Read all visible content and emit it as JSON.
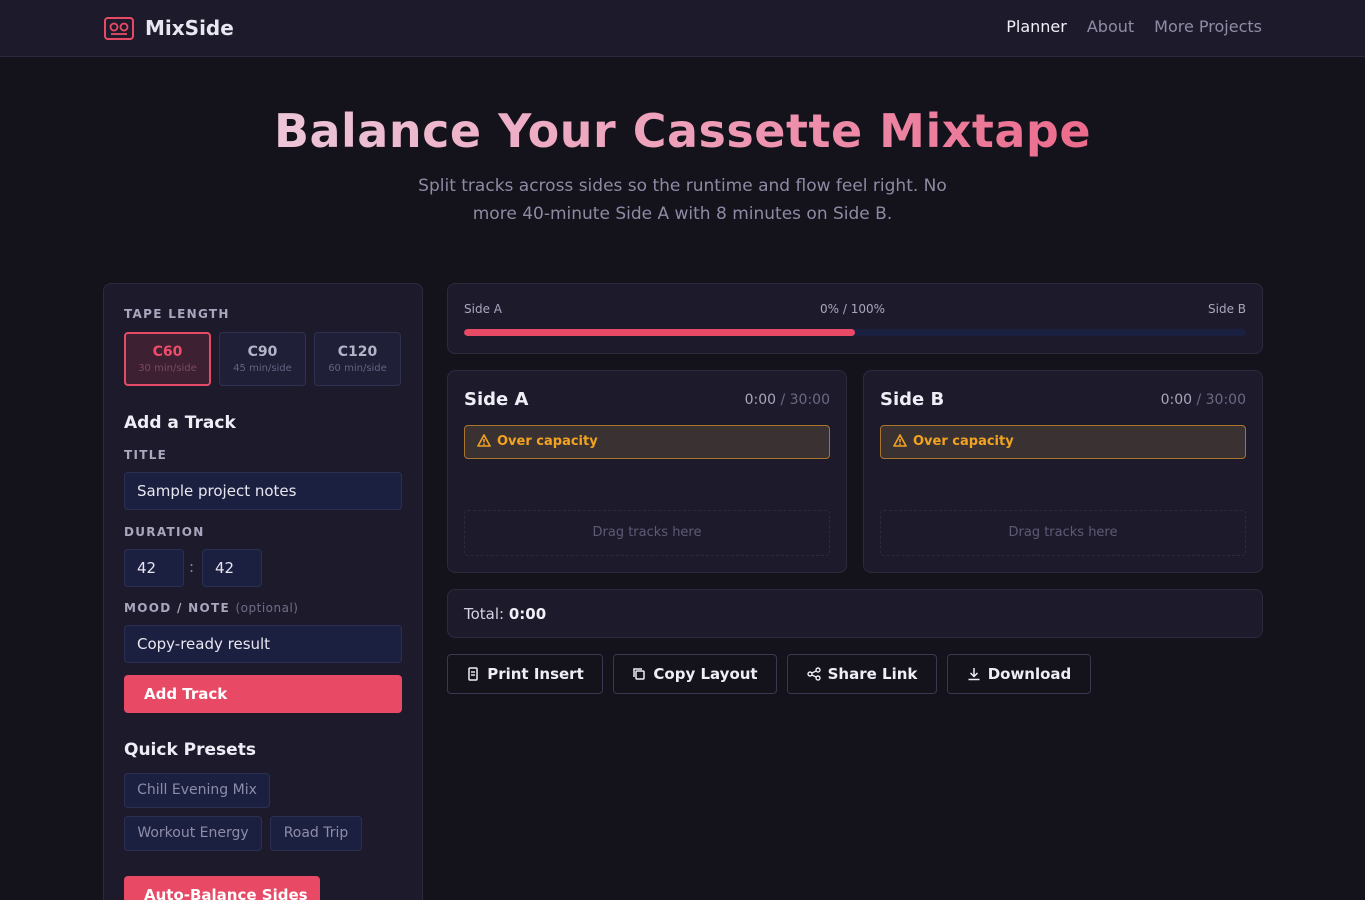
{
  "brand": {
    "name": "MixSide",
    "icon": "cassette-icon"
  },
  "nav": {
    "items": [
      "Planner",
      "About",
      "More Projects"
    ],
    "active": "Planner"
  },
  "hero": {
    "title": "Balance Your Cassette Mixtape",
    "subtitle": "Split tracks across sides so the runtime and flow feel right. No more 40-minute Side A with 8 minutes on Side B."
  },
  "colors": {
    "accent": "#e84a66",
    "warning": "#f2a421",
    "background": "#14121b",
    "panel": "#1d1b2b"
  },
  "tape": {
    "label": "TAPE LENGTH",
    "options": [
      {
        "name": "C60",
        "sub": "30 min/side",
        "selected": true
      },
      {
        "name": "C90",
        "sub": "45 min/side",
        "selected": false
      },
      {
        "name": "C120",
        "sub": "60 min/side",
        "selected": false
      }
    ]
  },
  "add_track": {
    "heading": "Add a Track",
    "title_label": "TITLE",
    "title_value": "Sample project notes",
    "duration_label": "DURATION",
    "minutes": "42",
    "seconds": "42",
    "separator": ":",
    "mood_label": "MOOD / NOTE",
    "mood_optional": "(optional)",
    "mood_value": "Copy-ready result",
    "button": "Add Track"
  },
  "presets": {
    "heading": "Quick Presets",
    "items": [
      "Chill Evening Mix",
      "Workout Energy",
      "Road Trip"
    ]
  },
  "auto_balance": "Auto-Balance Sides",
  "balance": {
    "left_label": "Side A",
    "center_label": "0% / 100%",
    "right_label": "Side B",
    "fill_fraction": 0.5
  },
  "sides": [
    {
      "title": "Side A",
      "time": "0:00",
      "max": " / 30:00",
      "warning": "Over capacity",
      "dropzone": "Drag tracks here"
    },
    {
      "title": "Side B",
      "time": "0:00",
      "max": " / 30:00",
      "warning": "Over capacity",
      "dropzone": "Drag tracks here"
    }
  ],
  "total": {
    "label": "Total: ",
    "value": "0:00"
  },
  "actions": [
    {
      "label": "Print Insert",
      "icon": "print-icon"
    },
    {
      "label": "Copy Layout",
      "icon": "copy-icon"
    },
    {
      "label": "Share Link",
      "icon": "share-icon"
    },
    {
      "label": "Download",
      "icon": "download-icon"
    }
  ]
}
